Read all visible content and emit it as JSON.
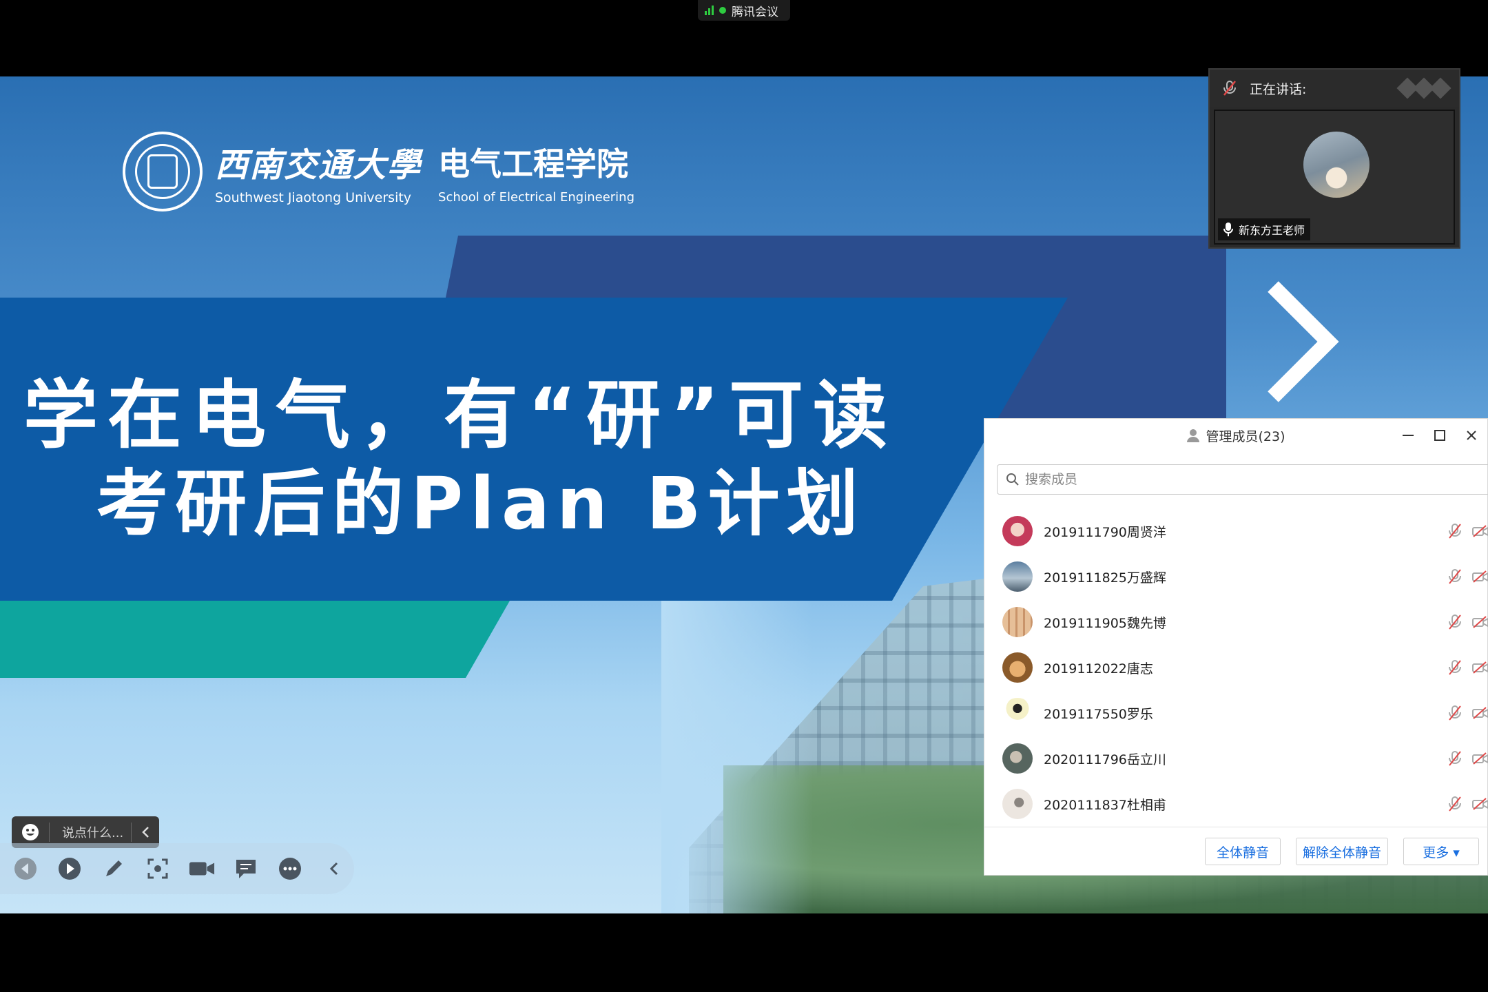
{
  "topbar": {
    "app_name": "腾讯会议"
  },
  "slide": {
    "university_cn": "西南交通大學",
    "university_en": "Southwest Jiaotong University",
    "school_cn": "电气工程学院",
    "school_en": "School of Electrical Engineering",
    "title": "学在电气，有“研”可读",
    "subtitle": "考研后的Plan B计划"
  },
  "speaking": {
    "label": "正在讲话:",
    "speaker_name": "新东方王老师"
  },
  "members_panel": {
    "title": "管理成员(23)",
    "search_placeholder": "搜索成员",
    "members": [
      {
        "name": "2019111790周贤洋",
        "avatar_color": "#c43a5a"
      },
      {
        "name": "2019111825万盛辉",
        "avatar_color": "#6f8fa8"
      },
      {
        "name": "2019111905魏先博",
        "avatar_color": "#d9a77a"
      },
      {
        "name": "2019112022唐志",
        "avatar_color": "#b07a3a"
      },
      {
        "name": "2019117550罗乐",
        "avatar_color": "#e8e07a"
      },
      {
        "name": "2020111796岳立川",
        "avatar_color": "#6a7d76"
      },
      {
        "name": "2020111837杜相甫",
        "avatar_color": "#d9d2cc"
      }
    ],
    "mute_all_label": "全体静音",
    "unmute_all_label": "解除全体静音",
    "more_label": "更多 ▾"
  },
  "chat": {
    "placeholder": "说点什么..."
  },
  "colors": {
    "slide_blue": "#0d5ba6",
    "slide_teal": "#0ea59e",
    "link_blue": "#1a6fe0",
    "green": "#2ecc40"
  }
}
